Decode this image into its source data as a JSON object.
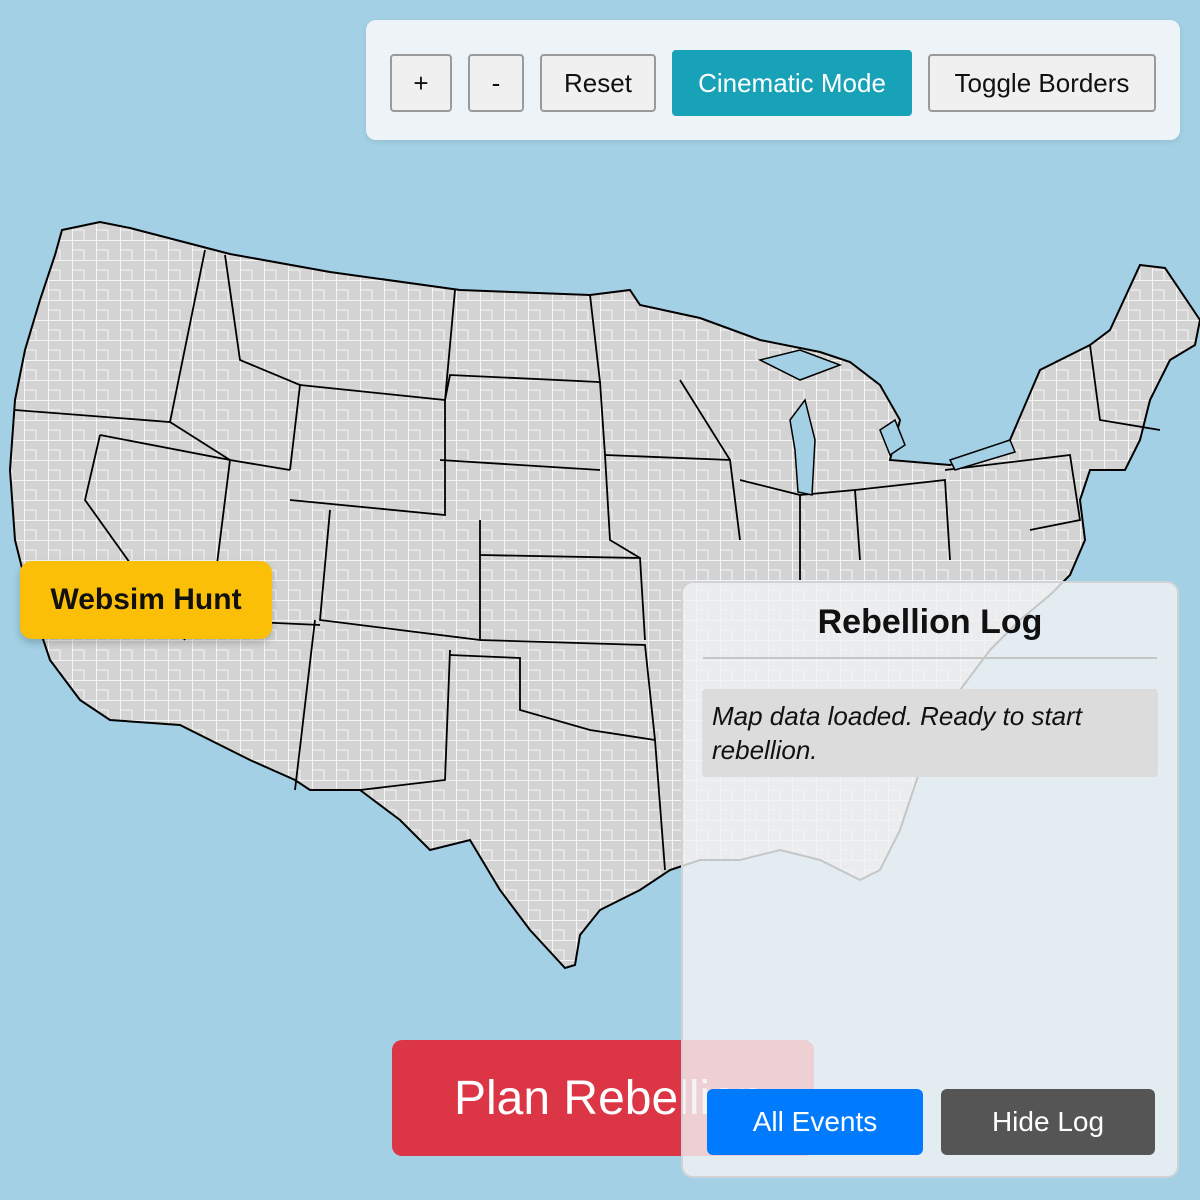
{
  "toolbar": {
    "zoom_in": "+",
    "zoom_out": "-",
    "reset": "Reset",
    "cinematic": "Cinematic Mode",
    "toggle_borders": "Toggle Borders"
  },
  "hunt_button": "Websim Hunt",
  "plan_button": "Plan Rebellion",
  "log": {
    "title": "Rebellion Log",
    "entries": [
      "Map data loaded. Ready to start rebellion."
    ],
    "all_events": "All Events",
    "hide_log": "Hide Log"
  },
  "colors": {
    "ocean": "#a3d0e4",
    "land": "#d3d3d3",
    "accent_teal": "#17a2b8",
    "hunt_yellow": "#fbbf08",
    "plan_red": "#dc3545",
    "all_events_blue": "#007bff",
    "hide_log_gray": "#555555"
  }
}
